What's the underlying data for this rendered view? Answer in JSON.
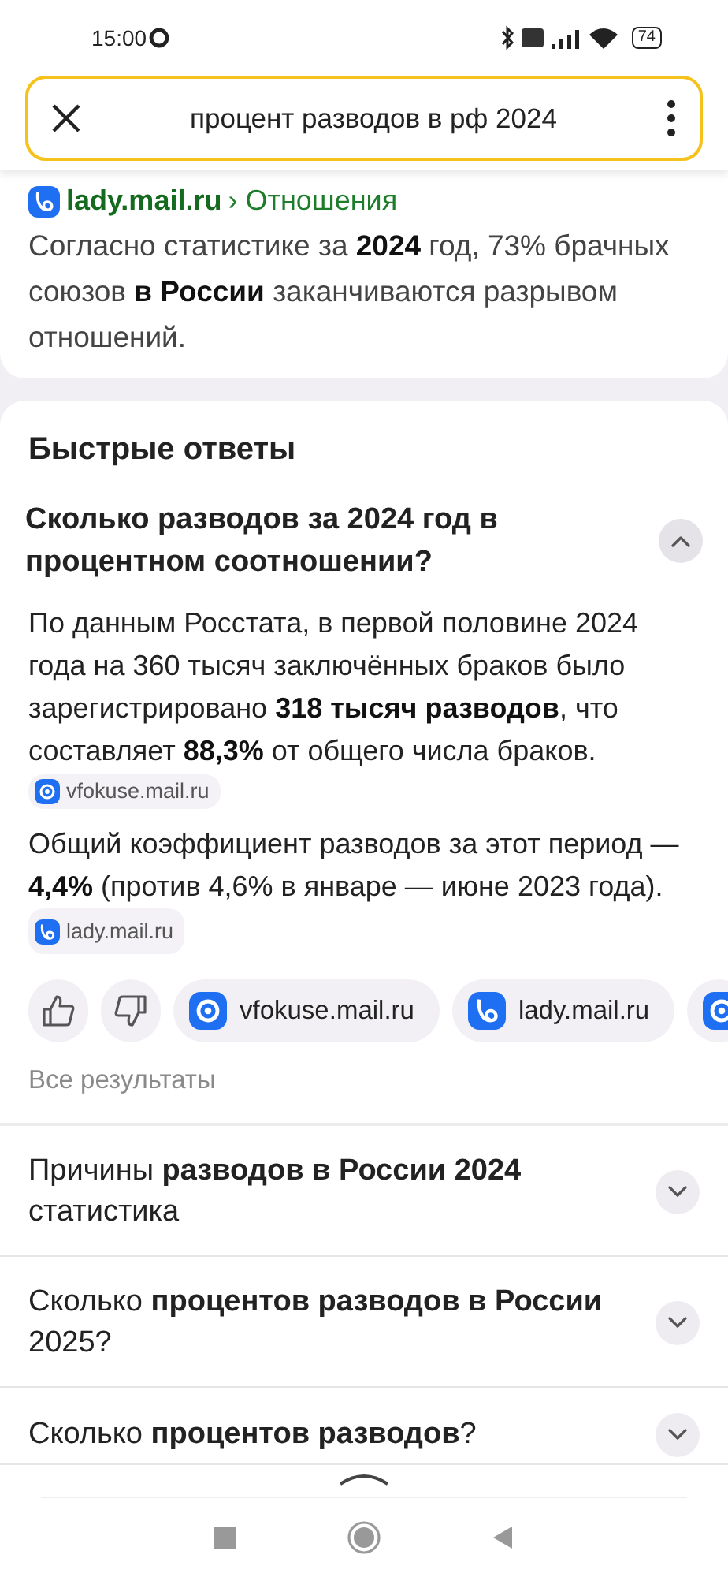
{
  "status_bar": {
    "time": "15:00",
    "battery": "74"
  },
  "search": {
    "value": "процент разводов в рф 2024"
  },
  "result": {
    "site": "lady.mail.ru",
    "breadcrumb": "› Отношения",
    "snippet": "Согласно статистике за **2024** год, 73% брачных союзов **в России** заканчиваются разрывом отношений."
  },
  "quick_answers": {
    "title": "Быстрые ответы",
    "question": {
      "text": "Сколько разводов за 2024 год в процентном соотношении?",
      "expanded": true
    },
    "paragraphs": [
      {
        "text": "По данным Росстата, в первой половине 2024 года на 360 тысяч заключённых браков было зарегистрировано **318 тысяч разводов**, что составляет **88,3%** от общего числа браков.",
        "source": {
          "label": "vfokuse.mail.ru",
          "kind": "ring"
        }
      },
      {
        "text": "Общий коэффициент разводов за этот период —  **4,4%** (против 4,6% в январе — июне 2023 года).",
        "source": {
          "label": "lady.mail.ru",
          "kind": "swirl"
        }
      }
    ],
    "sources": [
      {
        "label": "vfokuse.mail.ru",
        "kind": "ring"
      },
      {
        "label": "lady.mail.ru",
        "kind": "swirl"
      }
    ],
    "more": "Все результаты"
  },
  "related": [
    {
      "text": "Причины **разводов в России 2024** статистика",
      "expanded": false
    },
    {
      "text": "Сколько **процентов разводов в России** 2025?",
      "expanded": false
    },
    {
      "text": "Сколько **процентов разводов**?",
      "expanded": false
    }
  ]
}
